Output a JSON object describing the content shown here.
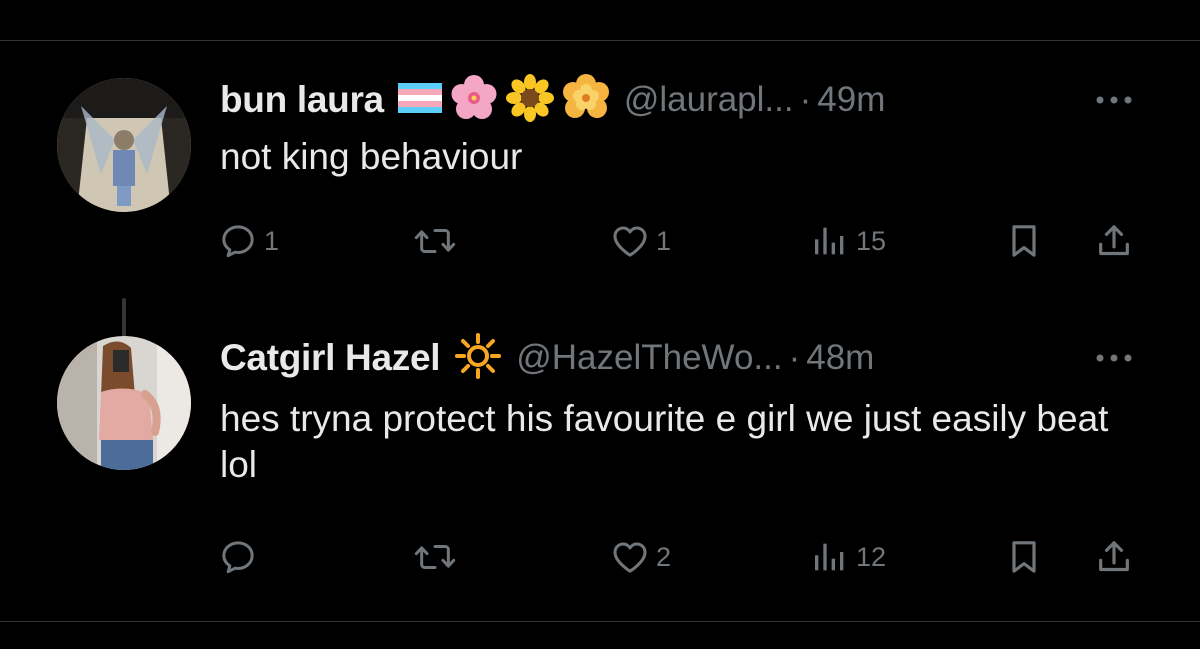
{
  "tweets": [
    {
      "display_name": "bun laura",
      "badges": [
        "trans-flag",
        "cherry-blossom",
        "sunflower",
        "blossom"
      ],
      "handle": "@laurapl...",
      "separator": "·",
      "time": "49m",
      "text": "not king behaviour",
      "reply_count": "1",
      "retweet_count": "",
      "like_count": "1",
      "view_count": "15"
    },
    {
      "display_name": "Catgirl Hazel",
      "badges": [
        "sun-emoji"
      ],
      "handle": "@HazelTheWo...",
      "separator": "·",
      "time": "48m",
      "text": "hes tryna protect his favourite e girl we just easily beat lol",
      "reply_count": "",
      "retweet_count": "",
      "like_count": "2",
      "view_count": "12"
    }
  ],
  "colors": {
    "background": "#000000",
    "text_primary": "#e7e9ea",
    "text_secondary": "#71767b",
    "divider": "#2f3336"
  }
}
